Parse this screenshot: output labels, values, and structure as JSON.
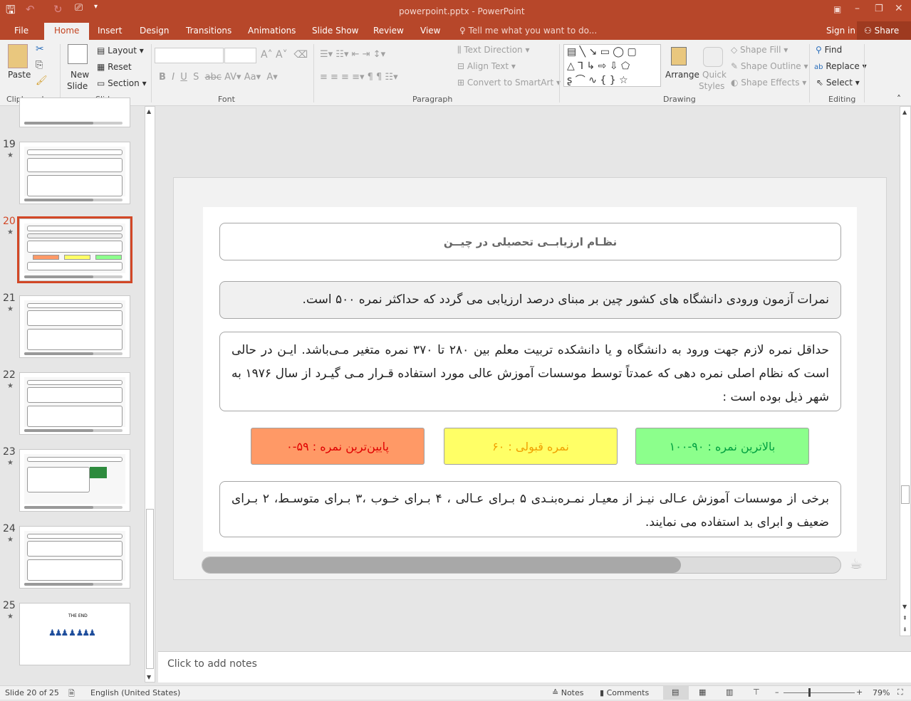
{
  "window": {
    "title": "powerpoint.pptx - PowerPoint",
    "controls": [
      "ribbon-display",
      "minimize",
      "restore",
      "close"
    ]
  },
  "quick_access": [
    "save-icon",
    "undo-icon",
    "redo-icon",
    "start-from-beginning-icon",
    "customize-icon"
  ],
  "tabs": [
    {
      "label": "File"
    },
    {
      "label": "Home",
      "active": true
    },
    {
      "label": "Insert"
    },
    {
      "label": "Design"
    },
    {
      "label": "Transitions"
    },
    {
      "label": "Animations"
    },
    {
      "label": "Slide Show"
    },
    {
      "label": "Review"
    },
    {
      "label": "View"
    }
  ],
  "tell_me": "Tell me what you want to do...",
  "sign_in": "Sign in",
  "share": "Share",
  "ribbon": {
    "clipboard": {
      "label": "Clipboard",
      "paste": "Paste"
    },
    "slides": {
      "label": "Slides",
      "new_slide": "New",
      "new_slide2": "Slide",
      "layout": "Layout",
      "reset": "Reset",
      "section": "Section"
    },
    "font": {
      "label": "Font"
    },
    "paragraph": {
      "label": "Paragraph",
      "text_direction": "Text Direction",
      "align_text": "Align Text",
      "convert": "Convert to SmartArt"
    },
    "drawing": {
      "label": "Drawing",
      "arrange": "Arrange",
      "quick": "Quick",
      "styles": "Styles",
      "shape_fill": "Shape Fill",
      "shape_outline": "Shape Outline",
      "shape_effects": "Shape Effects"
    },
    "editing": {
      "label": "Editing",
      "find": "Find",
      "replace": "Replace",
      "select": "Select"
    }
  },
  "thumbnails": [
    {
      "num": "19"
    },
    {
      "num": "20",
      "selected": true
    },
    {
      "num": "21"
    },
    {
      "num": "22"
    },
    {
      "num": "23"
    },
    {
      "num": "24"
    },
    {
      "num": "25",
      "text": "THE END"
    }
  ],
  "slide": {
    "title": "نظـام ارزیابــی تحصیلی در چیــن",
    "para1": "نمرات آزمون ورودی دانشگاه های کشور چین بر مبنای درصد ارزیابی می گردد که حداکثر نمره ۵۰۰ است.",
    "para2": "حداقل نمره لازم جهت ورود به دانشگاه و یا دانشکده تربیت معلم بین ۲۸۰ تا ۳۷۰ نمره متغیر مـی‌باشد. ایـن در حالی است که نظام اصلی نمره دهی که عمدتاً توسط موسسات آموزش عالی مورد استفاده قـرار مـی گیـرد از سال ۱۹۷۶ به شهر ذیل بوده است :",
    "grades": [
      {
        "label": "پایین‌ترین نمره : ۵۹-۰",
        "bg": "#ff9966",
        "color": "#e00000"
      },
      {
        "label": "نمره قبولی : ۶۰",
        "bg": "#ffff66",
        "color": "#f0a000"
      },
      {
        "label": "بالاترین نمره : ۹۰-۱۰۰",
        "bg": "#8cff8c",
        "color": "#00a040"
      }
    ],
    "para3": "برخی از موسسات آموزش عـالی نیـز از معیـار نمـره‌بنـدی ۵ بـرای عـالی ، ۴ بـرای خـوب ،۳ بـرای متوسـط، ۲ بـرای ضعیف و ابرای بد استفاده می نمایند.",
    "progress": 0.75
  },
  "notes_placeholder": "Click to add notes",
  "status": {
    "slide": "Slide 20 of 25",
    "language": "English (United States)",
    "notes": "Notes",
    "comments": "Comments",
    "zoom": "79%"
  },
  "accent": "#b7472a"
}
